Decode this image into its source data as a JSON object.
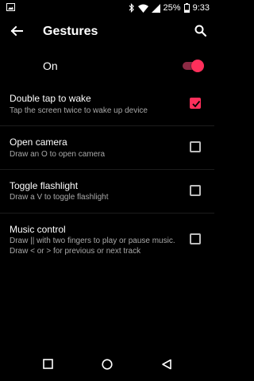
{
  "status_bar": {
    "battery_percent": "25%",
    "time": "9:33",
    "icons": [
      "image-notification-icon",
      "bluetooth-icon",
      "wifi-icon",
      "signal-icon",
      "battery-icon"
    ]
  },
  "app_bar": {
    "title": "Gestures",
    "back_icon": "arrow-back-icon",
    "search_icon": "search-icon"
  },
  "master_switch": {
    "label": "On",
    "state": "on"
  },
  "settings": [
    {
      "title": "Double tap to wake",
      "summary": "Tap the screen twice to wake up device",
      "checked": true
    },
    {
      "title": "Open camera",
      "summary": "Draw an O to open camera",
      "checked": false
    },
    {
      "title": "Toggle flashlight",
      "summary": "Draw a V to toggle flashlight",
      "checked": false
    },
    {
      "title": "Music control",
      "summary": "Draw || with two fingers to play or pause music. Draw < or > for previous or next track",
      "checked": false
    }
  ],
  "nav_bar": {
    "icons": [
      "recents-square-icon",
      "home-circle-icon",
      "back-triangle-icon"
    ]
  },
  "colors": {
    "accent": "#ff2f5b",
    "background": "#000000",
    "summary_text": "#a8a8a8"
  }
}
